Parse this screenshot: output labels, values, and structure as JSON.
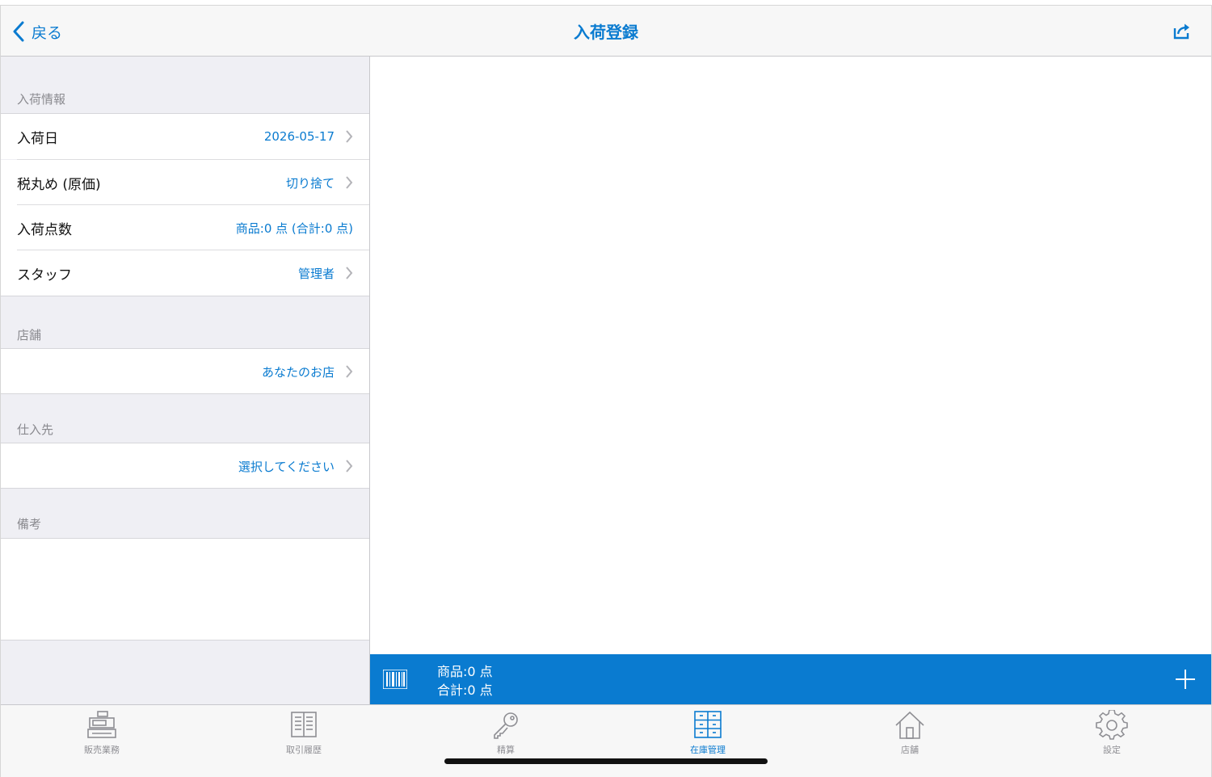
{
  "nav": {
    "back_label": "戻る",
    "title": "入荷登録"
  },
  "sections": {
    "arrival_info": {
      "header": "入荷情報",
      "rows": [
        {
          "label": "入荷日",
          "value": "2026-05-17",
          "chevron": true
        },
        {
          "label": "税丸め (原価)",
          "value": "切り捨て",
          "chevron": true
        },
        {
          "label": "入荷点数",
          "value": "商品:0 点 (合計:0 点)",
          "chevron": false
        },
        {
          "label": "スタッフ",
          "value": "管理者",
          "chevron": true
        }
      ]
    },
    "store": {
      "header": "店舗",
      "value": "あなたのお店"
    },
    "supplier": {
      "header": "仕入先",
      "value": "選択してください"
    },
    "memo": {
      "header": "備考"
    }
  },
  "bottom_bar": {
    "items_count": "商品:0 点",
    "total_count": "合計:0 点"
  },
  "tabs": [
    {
      "label": "販売業務",
      "icon": "register-icon",
      "active": false
    },
    {
      "label": "取引履歴",
      "icon": "book-icon",
      "active": false
    },
    {
      "label": "精算",
      "icon": "key-icon",
      "active": false
    },
    {
      "label": "在庫管理",
      "icon": "cabinet-icon",
      "active": true
    },
    {
      "label": "店舗",
      "icon": "house-icon",
      "active": false
    },
    {
      "label": "設定",
      "icon": "gear-icon",
      "active": false
    }
  ],
  "colors": {
    "accent": "#0a7bd0",
    "inactive": "#8e8e93",
    "background": "#efeff4"
  }
}
